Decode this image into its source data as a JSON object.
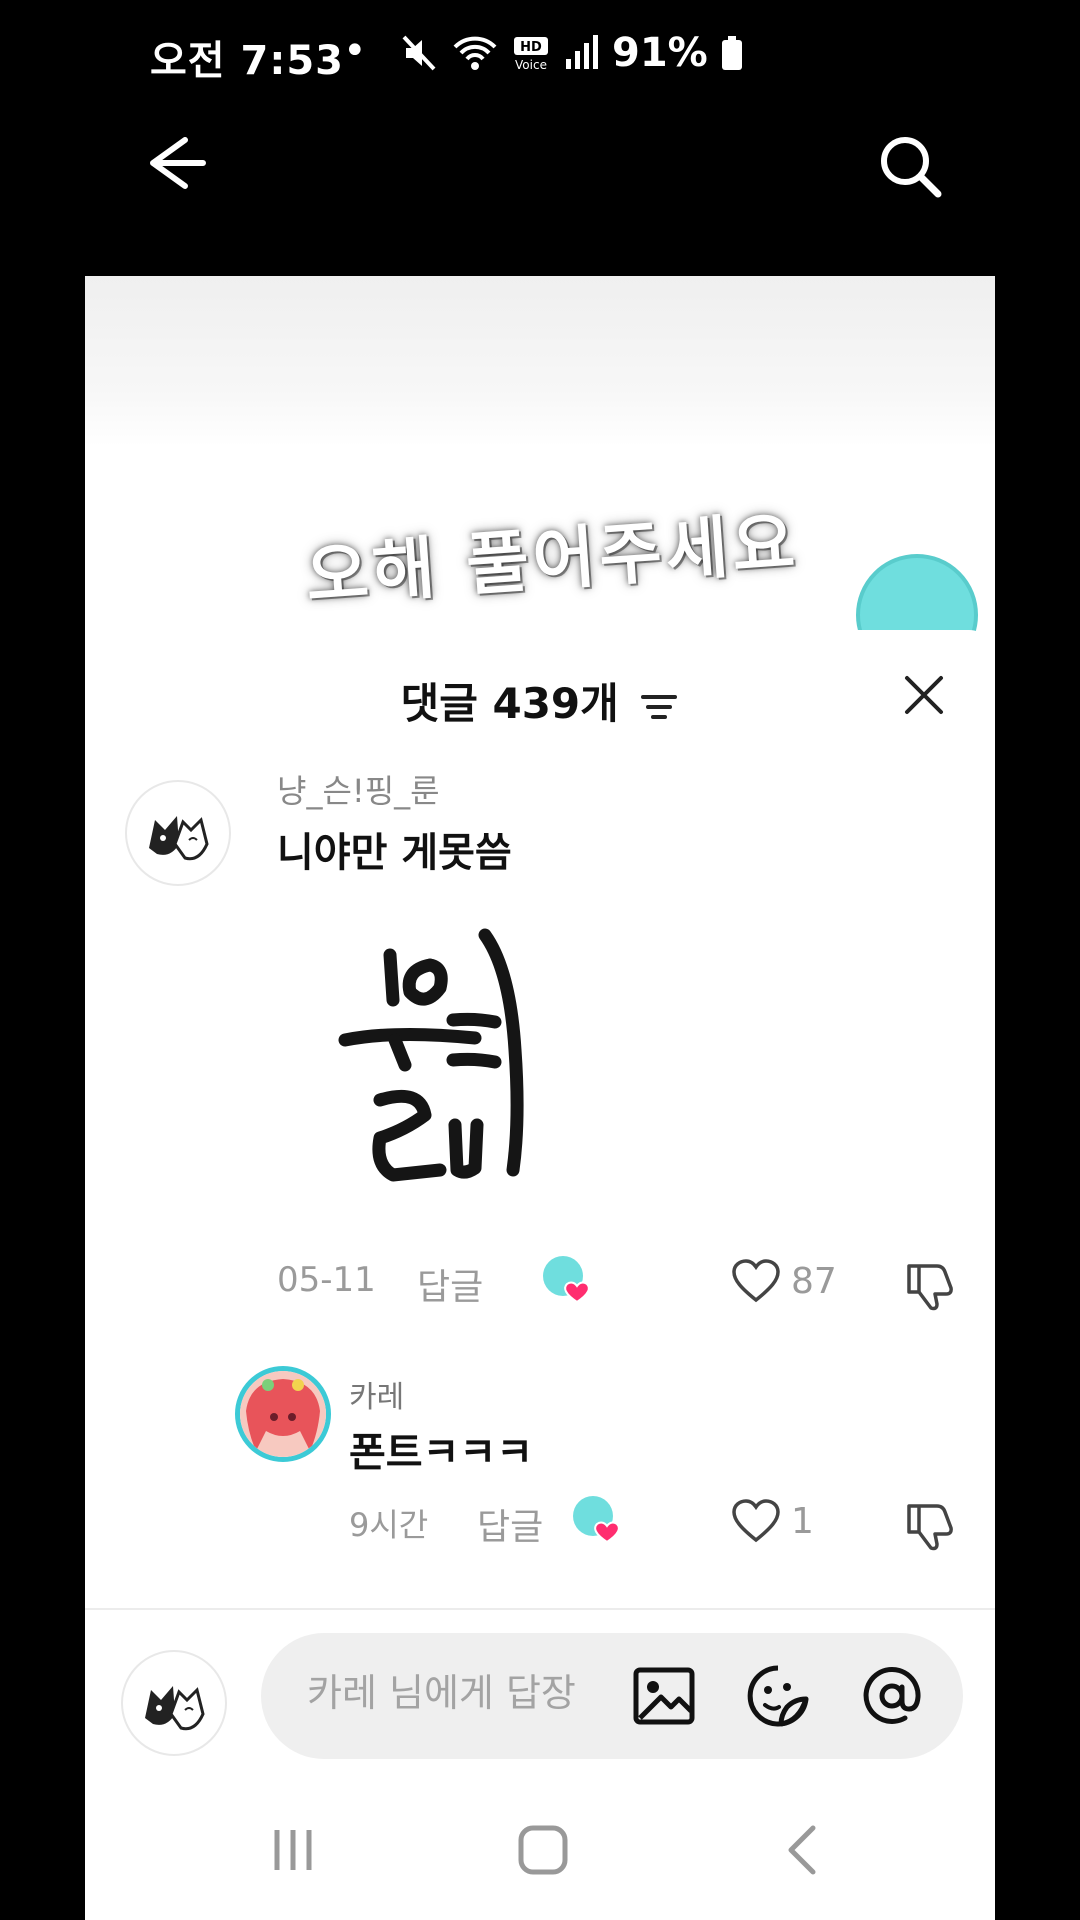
{
  "status_bar": {
    "time": "오전 7:53",
    "dot": "•",
    "battery": "91%"
  },
  "video": {
    "caption": "오해 풀어주세요"
  },
  "comments_panel": {
    "title": "댓글 439개",
    "comments": [
      {
        "username": "냥_슨!핑_룬",
        "text": "니야만 게못씀",
        "date": "05-11",
        "reply_label": "답글",
        "likes": "87"
      },
      {
        "username": "카레",
        "text": "폰트ㅋㅋㅋ",
        "date": "9시간",
        "reply_label": "답글",
        "likes": "1"
      }
    ]
  },
  "composer": {
    "placeholder": "카레 님에게 답장"
  },
  "icons": {
    "back": "arrow-left-icon",
    "search": "search-icon",
    "sort": "sort-icon",
    "close": "close-icon",
    "like": "heart-icon",
    "dislike": "thumbs-down-icon",
    "image": "image-icon",
    "emoji": "sticker-emoji-icon",
    "mention": "at-sign-icon",
    "recent_apps": "recent-apps-icon",
    "home": "home-icon",
    "nav_back": "nav-back-icon"
  },
  "colors": {
    "accent_teal": "#6fdede",
    "heart_pink": "#ff2d6f"
  }
}
